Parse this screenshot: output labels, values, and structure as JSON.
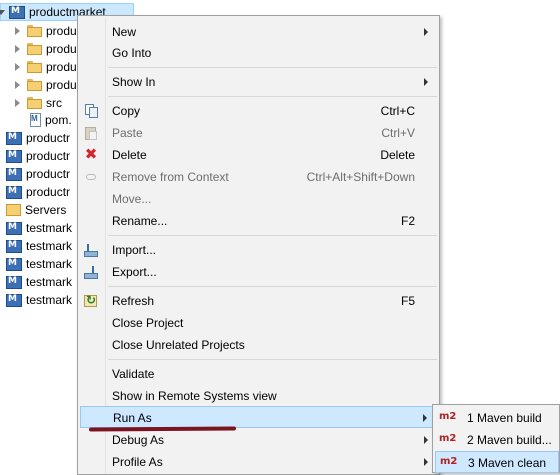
{
  "tree": {
    "root": "productmarket",
    "children": [
      "produ",
      "produ",
      "produ",
      "produ",
      "src",
      "pom."
    ],
    "projects": [
      "productr",
      "productr",
      "productr",
      "productr"
    ],
    "servers": "Servers",
    "test_projects": [
      "testmark",
      "testmark",
      "testmark",
      "testmark",
      "testmark"
    ]
  },
  "menu": {
    "new": "New",
    "go_into": "Go Into",
    "show_in": "Show In",
    "copy": "Copy",
    "copy_accel": "Ctrl+C",
    "paste": "Paste",
    "paste_accel": "Ctrl+V",
    "delete": "Delete",
    "delete_accel": "Delete",
    "remove_ctx": "Remove from Context",
    "remove_ctx_accel": "Ctrl+Alt+Shift+Down",
    "move": "Move...",
    "rename": "Rename...",
    "rename_accel": "F2",
    "import": "Import...",
    "export": "Export...",
    "refresh": "Refresh",
    "refresh_accel": "F5",
    "close_project": "Close Project",
    "close_unrelated": "Close Unrelated Projects",
    "validate": "Validate",
    "show_remote": "Show in Remote Systems view",
    "run_as": "Run As",
    "debug_as": "Debug As",
    "profile_as": "Profile As"
  },
  "submenu": {
    "badge": "m2",
    "items": [
      "1 Maven build",
      "2 Maven build...",
      "3 Maven clean"
    ]
  }
}
